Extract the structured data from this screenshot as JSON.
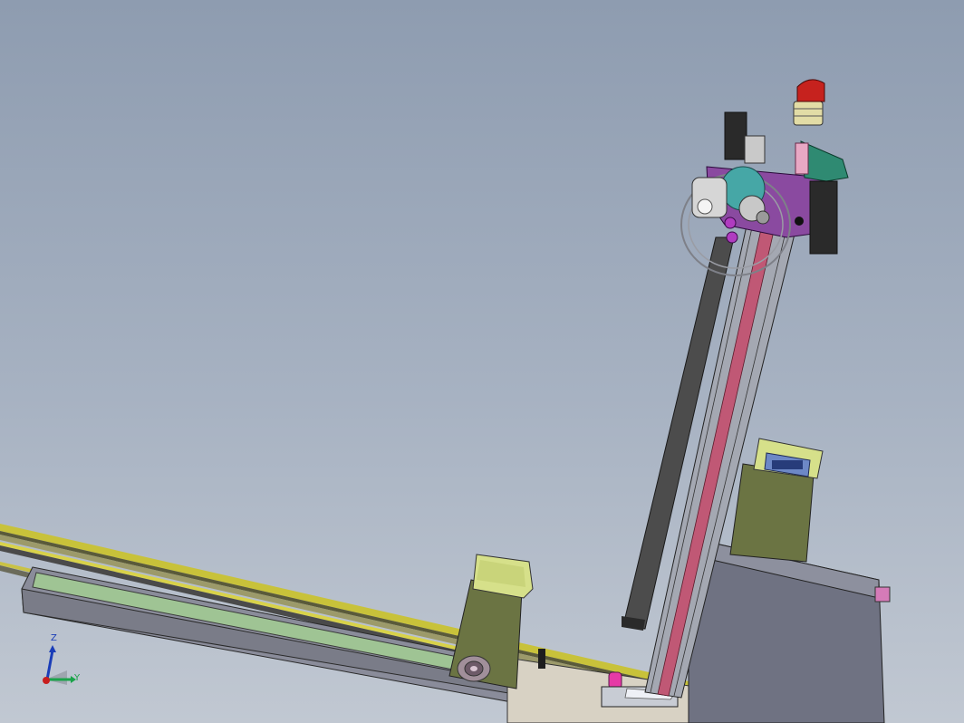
{
  "viewport": {
    "background_top": "#8e9cb0",
    "background_bottom": "#c1c8d2"
  },
  "triad": {
    "z_label": "Z",
    "y_label": "Y",
    "z_color": "#1a3db8",
    "y_color": "#1aa34a",
    "x_color": "#c81e1e"
  },
  "scene": {
    "description_icons": [
      "cad-assembly",
      "linear-axis",
      "conveyor",
      "warning-light"
    ]
  }
}
